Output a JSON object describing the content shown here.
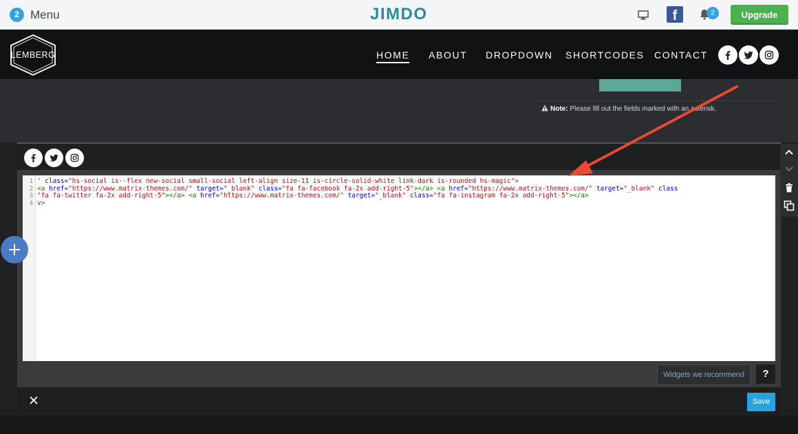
{
  "jimdo_bar": {
    "menu_count": "2",
    "menu_label": "Menu",
    "logo": "JIMDO",
    "notification_count": "2",
    "upgrade_label": "Upgrade",
    "icons": [
      "monitor-icon",
      "facebook-icon",
      "bell-icon"
    ]
  },
  "site_header": {
    "logo_text": "LEMBERG",
    "nav": [
      "HOME",
      "ABOUT",
      "DROPDOWN",
      "SHORTCODES",
      "CONTACT"
    ],
    "active_nav": "HOME",
    "social_icons": [
      "facebook-icon",
      "twitter-icon",
      "instagram-icon"
    ]
  },
  "page": {
    "note_label": "Note:",
    "note_text": " Please fill out the fields marked with an asterisk."
  },
  "editor": {
    "line_numbers": [
      "1",
      "2",
      "3",
      "4"
    ],
    "code": {
      "l1_a": "' class=",
      "l1_b": "\"hs-social is--flex new-social small-social left-align size-11 is-circle-solid-white link-dark is-rounded hs-magic\"",
      "l1_c": ">",
      "l2_a": "<a ",
      "l2_b": "href=",
      "l2_c": "\"https://www.matrix-themes.com/\"",
      "l2_d": " target=",
      "l2_e": "\"_blank\"",
      "l2_f": " class=",
      "l2_g": "\"fa fa-facebook fa-2x add-right-5\"",
      "l2_h": "></a> <a ",
      "l2_i": "href=",
      "l2_j": "\"https://www.matrix-themes.com/\"",
      "l2_k": " target=",
      "l2_l": "\"_blank\"",
      "l2_m": " class",
      "l3_a": "\"fa fa-twitter fa-2x add-right-5\"",
      "l3_b": "></a> <a ",
      "l3_c": "href=",
      "l3_d": "\"https://www.matrix-themes.com/\"",
      "l3_e": " target=",
      "l3_f": "\"_blank\"",
      "l3_g": " class=",
      "l3_h": "\"fa fa-instagram fa-2x add-right-5\"",
      "l3_i": "></a>",
      "l4_a": "v>"
    },
    "widgets_label": "Widgets we recommend",
    "help_label": "?",
    "save_label": "Save"
  },
  "side_controls": [
    "chevron-up-icon",
    "chevron-down-icon",
    "trash-icon",
    "copy-icon"
  ],
  "colors": {
    "accent_blue": "#29a3df",
    "upgrade_green": "#4caf50",
    "jimdo_teal": "#2a8c99",
    "arrow_red": "#e84a32"
  }
}
